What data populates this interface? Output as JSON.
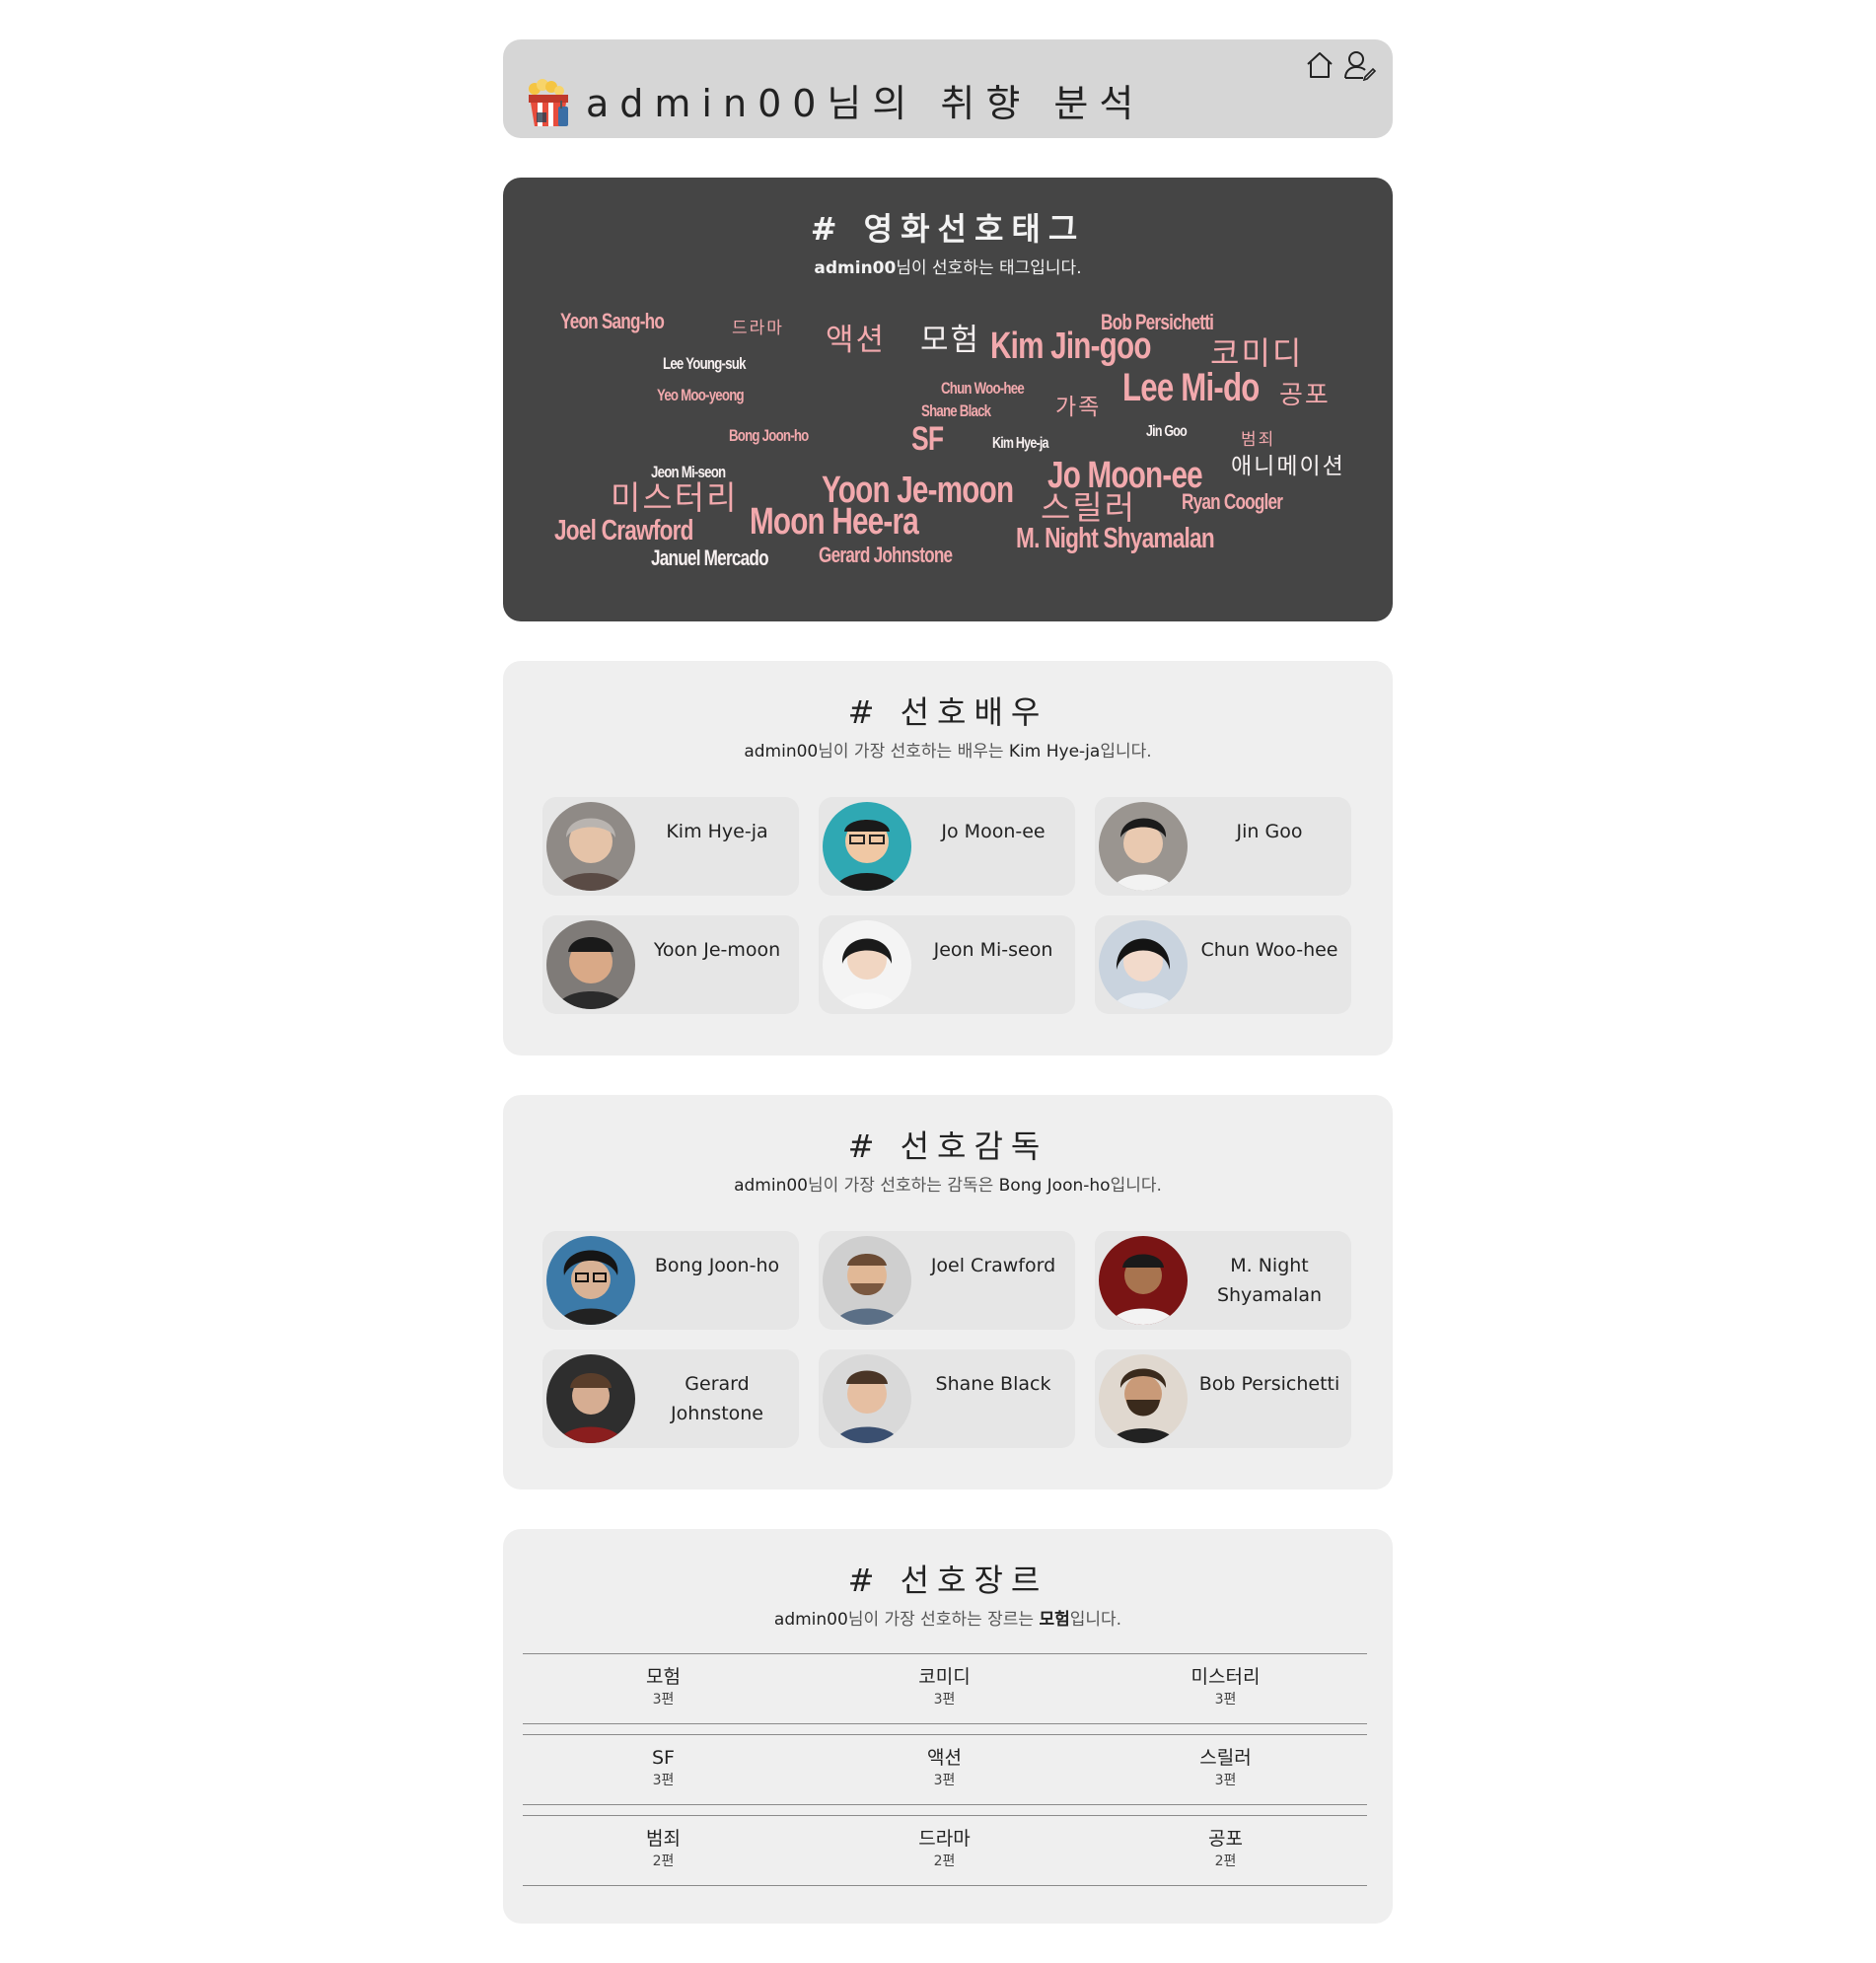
{
  "header": {
    "title": "admin00님의 취향 분석",
    "home_icon": "home-icon",
    "user_icon": "user-icon",
    "logo_icon": "popcorn-icon"
  },
  "tag_cloud": {
    "title": "# 영화선호태그",
    "subtitle_name": "admin00",
    "subtitle_rest": "님이 선호하는 태그입니다.",
    "tag_color": "#f2a9ad",
    "tags": [
      "Yeon Sang-ho",
      "드라마",
      "액션",
      "모험",
      "Kim Jin-goo",
      "Bob Persichetti",
      "코미디",
      "Lee Young-suk",
      "Yeo Moo-yeong",
      "Chun Woo-hee",
      "Shane Black",
      "가족",
      "Lee Mi-do",
      "공포",
      "Bong Joon-ho",
      "SF",
      "Kim Hye-ja",
      "Jin Goo",
      "범죄",
      "Jeon Mi-seon",
      "Yoon Je-moon",
      "Jo Moon-ee",
      "애니메이션",
      "미스터리",
      "스릴러",
      "Ryan Coogler",
      "Joel Crawford",
      "Moon Hee-ra",
      "M. Night Shyamalan",
      "Januel Mercado",
      "Gerard Johnstone"
    ]
  },
  "actors": {
    "title": "# 선호배우",
    "subtitle_name": "admin00",
    "subtitle_mid": "님이 가장 선호하는 배우는 ",
    "subtitle_top": "Kim Hye-ja",
    "subtitle_end": "입니다.",
    "items": [
      {
        "name": "Kim Hye-ja"
      },
      {
        "name": "Jo Moon-ee"
      },
      {
        "name": "Jin Goo"
      },
      {
        "name": "Yoon Je-moon"
      },
      {
        "name": "Jeon Mi-seon"
      },
      {
        "name": "Chun Woo-hee"
      }
    ]
  },
  "directors": {
    "title": "# 선호감독",
    "subtitle_name": "admin00",
    "subtitle_mid": "님이 가장 선호하는 감독은 ",
    "subtitle_top": "Bong Joon-ho",
    "subtitle_end": "입니다.",
    "items": [
      {
        "name": "Bong Joon-ho"
      },
      {
        "name": "Joel Crawford"
      },
      {
        "name": "M. Night Shyamalan"
      },
      {
        "name": "Gerard Johnstone"
      },
      {
        "name": "Shane Black"
      },
      {
        "name": "Bob Persichetti"
      }
    ]
  },
  "genres": {
    "title": "# 선호장르",
    "subtitle_name": "admin00",
    "subtitle_mid": "님이 가장 선호하는 장르는 ",
    "subtitle_top": "모험",
    "subtitle_end": "입니다.",
    "rows": [
      [
        {
          "genre": "모험",
          "count": "3편"
        },
        {
          "genre": "코미디",
          "count": "3편"
        },
        {
          "genre": "미스터리",
          "count": "3편"
        }
      ],
      [
        {
          "genre": "SF",
          "count": "3편"
        },
        {
          "genre": "액션",
          "count": "3편"
        },
        {
          "genre": "스릴러",
          "count": "3편"
        }
      ],
      [
        {
          "genre": "범죄",
          "count": "2편"
        },
        {
          "genre": "드라마",
          "count": "2편"
        },
        {
          "genre": "공포",
          "count": "2편"
        }
      ]
    ]
  }
}
